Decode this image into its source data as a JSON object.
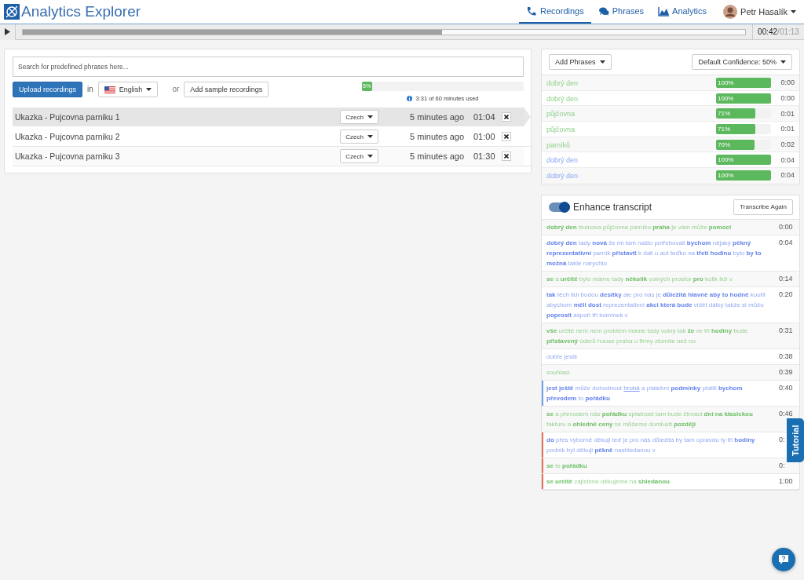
{
  "app": {
    "title": "Analytics Explorer"
  },
  "nav": [
    {
      "label": "Recordings",
      "selected": true
    },
    {
      "label": "Phrases",
      "selected": false
    },
    {
      "label": "Analytics",
      "selected": false
    }
  ],
  "user": {
    "name": "Petr Hasalík"
  },
  "player": {
    "level": 0.58,
    "current": "00:42",
    "total": "/01:13"
  },
  "upload": {
    "search_placeholder": "Search for predefined phrases here...",
    "upload_button": "Upload recordings",
    "in_label": "in",
    "language": "English",
    "or_label": "or",
    "sample_button": "Add sample recordings",
    "usage": {
      "level": 0.05,
      "label": "5%"
    },
    "usage_note": "3:31 of 60 minutes used"
  },
  "recordings": [
    {
      "name": "Ukazka - Pujcovna parniku 1",
      "language": "Czech",
      "age": "5 minutes ago",
      "duration": "01:04",
      "selected": true
    },
    {
      "name": "Ukazka - Pujcovna parniku 2",
      "language": "Czech",
      "age": "5 minutes ago",
      "duration": "01:00",
      "selected": false
    },
    {
      "name": "Ukazka - Pujcovna parniku 3",
      "language": "Czech",
      "age": "5 minutes ago",
      "duration": "01:30",
      "selected": false
    }
  ],
  "phrases_panel": {
    "add_button": "Add Phrases",
    "confidence_button": "Default Confidence: 50%"
  },
  "phrases": [
    {
      "text": "dobrý den",
      "kind": "agent",
      "level": 1.0,
      "label": "100%",
      "time": "0:00"
    },
    {
      "text": "dobrý den",
      "kind": "agent",
      "level": 1.0,
      "label": "100%",
      "time": "0:00"
    },
    {
      "text": "půjčovna",
      "kind": "agent",
      "level": 0.71,
      "label": "71%",
      "time": "0:01"
    },
    {
      "text": "půjčovna",
      "kind": "agent",
      "level": 0.71,
      "label": "71%",
      "time": "0:01"
    },
    {
      "text": "parníků",
      "kind": "agent",
      "level": 0.7,
      "label": "70%",
      "time": "0:02"
    },
    {
      "text": "dobrý den",
      "kind": "caller",
      "level": 1.0,
      "label": "100%",
      "time": "0:04"
    },
    {
      "text": "dobrý den",
      "kind": "caller",
      "level": 1.0,
      "label": "100%",
      "time": "0:04"
    }
  ],
  "transcript_panel": {
    "enhance": {
      "on": true,
      "label": "Enhance transcript"
    },
    "transcribe_button": "Transcribe Again"
  },
  "transcript": [
    {
      "kind": "agent",
      "time": "0:00",
      "segments": [
        {
          "text": "dobrý den",
          "kind": "keyword"
        },
        {
          "text": "trutnova půjčovna parníku",
          "kind": "word"
        },
        {
          "text": "praha",
          "kind": "keyword"
        },
        {
          "text": "je vám může",
          "kind": "word"
        },
        {
          "text": "pomoci",
          "kind": "keyword"
        }
      ]
    },
    {
      "kind": "caller",
      "time": "0:04",
      "segments": [
        {
          "text": "dobrý den",
          "kind": "keyword"
        },
        {
          "text": "tady",
          "kind": "word"
        },
        {
          "text": "nová",
          "kind": "keyword"
        },
        {
          "text": "že mi tam našlo potřebovali",
          "kind": "word"
        },
        {
          "text": "bychom",
          "kind": "keyword"
        },
        {
          "text": "nějaký",
          "kind": "word"
        },
        {
          "text": "pěkný reprezentativní",
          "kind": "keyword"
        },
        {
          "text": "parník",
          "kind": "word"
        },
        {
          "text": "přistavit",
          "kind": "keyword"
        },
        {
          "text": "k dali u aut teďko na",
          "kind": "word"
        },
        {
          "text": "třetí hodinu",
          "kind": "keyword"
        },
        {
          "text": "bylo",
          "kind": "word"
        },
        {
          "text": "by to možná",
          "kind": "keyword"
        },
        {
          "text": "takle narychlo",
          "kind": "word"
        }
      ]
    },
    {
      "kind": "agent",
      "time": "0:14",
      "segments": [
        {
          "text": "se",
          "kind": "keyword"
        },
        {
          "text": "a",
          "kind": "word"
        },
        {
          "text": "určitě",
          "kind": "keyword"
        },
        {
          "text": "bylo máme tady",
          "kind": "word"
        },
        {
          "text": "několik",
          "kind": "keyword"
        },
        {
          "text": "volných prostor",
          "kind": "word"
        },
        {
          "text": "pro",
          "kind": "keyword"
        },
        {
          "text": "kolik lidí v",
          "kind": "word"
        }
      ]
    },
    {
      "kind": "caller",
      "time": "0:20",
      "segments": [
        {
          "text": "tak",
          "kind": "keyword"
        },
        {
          "text": "těch lidí budou",
          "kind": "word"
        },
        {
          "text": "desítky",
          "kind": "keyword"
        },
        {
          "text": "ale pro nás je",
          "kind": "word"
        },
        {
          "text": "důležitá hlavně aby to hodně",
          "kind": "keyword"
        },
        {
          "text": "kouřil abychom",
          "kind": "word"
        },
        {
          "text": "měli dost",
          "kind": "keyword"
        },
        {
          "text": "reprezentativní",
          "kind": "word"
        },
        {
          "text": "akci která bude",
          "kind": "keyword"
        },
        {
          "text": "vidět dálky takže si můžu",
          "kind": "word"
        },
        {
          "text": "poprosit",
          "kind": "keyword"
        },
        {
          "text": "aspoň tři komínek v",
          "kind": "word"
        }
      ]
    },
    {
      "kind": "agent",
      "time": "0:31",
      "segments": [
        {
          "text": "vše",
          "kind": "keyword"
        },
        {
          "text": "určitě není není problém máme tady volný tak",
          "kind": "word"
        },
        {
          "text": "že",
          "kind": "keyword"
        },
        {
          "text": "ve tři",
          "kind": "word"
        },
        {
          "text": "hodiny",
          "kind": "keyword"
        },
        {
          "text": "bude",
          "kind": "word"
        },
        {
          "text": "přistavený",
          "kind": "keyword"
        },
        {
          "text": "úderů house praha u firmy zlomíte než no",
          "kind": "word"
        }
      ]
    },
    {
      "kind": "caller",
      "time": "0:38",
      "segments": [
        {
          "text": "dobře jestli",
          "kind": "word"
        }
      ]
    },
    {
      "kind": "agent",
      "time": "0:39",
      "segments": [
        {
          "text": "souhlasí",
          "kind": "word"
        }
      ]
    },
    {
      "kind": "caller",
      "time": "0:40",
      "color": "#6fa0ee",
      "segments": [
        {
          "text": "jest ještě",
          "kind": "keyword"
        },
        {
          "text": "může dohodnout",
          "kind": "word"
        },
        {
          "text": "hrubá",
          "kind": "flagged"
        },
        {
          "text": "a platební",
          "kind": "word"
        },
        {
          "text": "podmínky",
          "kind": "keyword"
        },
        {
          "text": "platili",
          "kind": "word"
        },
        {
          "text": "bychom převodem",
          "kind": "keyword"
        },
        {
          "text": "to",
          "kind": "word"
        },
        {
          "text": "pořádku",
          "kind": "keyword"
        }
      ]
    },
    {
      "kind": "agent",
      "time": "0:46",
      "segments": [
        {
          "text": "se",
          "kind": "keyword"
        },
        {
          "text": "a převodem nás",
          "kind": "word"
        },
        {
          "text": "pořádku",
          "kind": "keyword"
        },
        {
          "text": "splatnost tam bude čtrnáct",
          "kind": "word"
        },
        {
          "text": "dní na klasickou",
          "kind": "keyword"
        },
        {
          "text": "fakturu a",
          "kind": "word"
        },
        {
          "text": "ohledně ceny",
          "kind": "keyword"
        },
        {
          "text": "se můžeme domluvit",
          "kind": "word"
        },
        {
          "text": "později",
          "kind": "keyword"
        }
      ]
    },
    {
      "kind": "caller",
      "time": "0:",
      "color": "#e8705e",
      "segments": [
        {
          "text": "do",
          "kind": "keyword"
        },
        {
          "text": "přes výborně děkuji teď je pro nás důležitá by tam opravdu ty tři",
          "kind": "word"
        },
        {
          "text": "hodiny",
          "kind": "keyword"
        },
        {
          "text": "podnik byl děkuji",
          "kind": "word"
        },
        {
          "text": "pěkně",
          "kind": "keyword"
        },
        {
          "text": "nashledanou v",
          "kind": "word"
        }
      ]
    },
    {
      "kind": "agent",
      "time": "0:",
      "color": "#e8705e",
      "segments": [
        {
          "text": "se",
          "kind": "keyword"
        },
        {
          "text": "to",
          "kind": "word"
        },
        {
          "text": "pořádku",
          "kind": "keyword"
        }
      ]
    },
    {
      "kind": "agent",
      "time": "1:00",
      "color": "#e8705e",
      "segments": [
        {
          "text": "se určitě",
          "kind": "keyword"
        },
        {
          "text": "zajistíme děkujeme na",
          "kind": "word"
        },
        {
          "text": "shledanou",
          "kind": "keyword"
        }
      ]
    }
  ],
  "tutorial_tab": "Tutorial"
}
